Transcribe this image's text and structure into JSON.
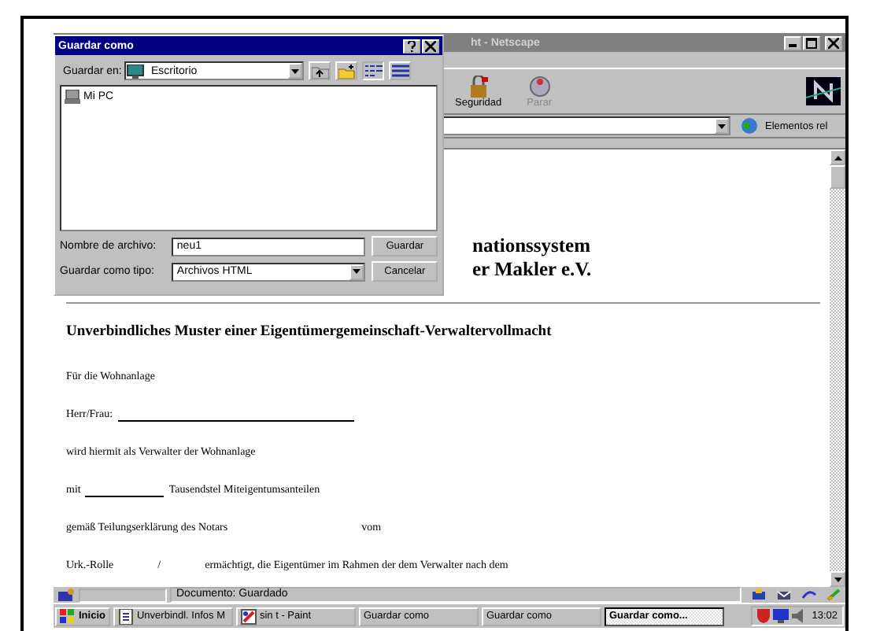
{
  "browser": {
    "title": "ht - Netscape",
    "toolbar": [
      {
        "label": "Seguridad",
        "kind": "lock",
        "disabled": false
      },
      {
        "label": "Parar",
        "kind": "stop",
        "disabled": true
      }
    ],
    "related": "Elementos rel",
    "page": {
      "heading": [
        "nationssystem",
        "er Makler e.V."
      ],
      "title": "Unverbindliches Muster einer Eigentümergemeinschaft-Verwaltervollmacht",
      "lines": [
        [
          {
            "kind": "text",
            "text": "Für die Wohnanlage"
          }
        ],
        [
          {
            "kind": "text",
            "text": "Herr/Frau:"
          },
          {
            "kind": "long_blank"
          }
        ],
        [
          {
            "kind": "text",
            "text": "wird hiermit als Verwalter der Wohnanlage"
          }
        ],
        [
          {
            "kind": "text",
            "text": "mit"
          },
          {
            "kind": "short_blank"
          },
          {
            "kind": "text",
            "text": "Tausendstel Miteigentumsanteilen"
          }
        ],
        [
          {
            "kind": "text",
            "text": "gemäß Teilungserklärung des Notars"
          },
          {
            "kind": "wide_gap"
          },
          {
            "kind": "text",
            "text": "vom"
          }
        ],
        [
          {
            "kind": "text",
            "text": "Urk.-Rolle"
          },
          {
            "kind": "narrow_gap"
          },
          {
            "kind": "text",
            "text": "/"
          },
          {
            "kind": "narrow_gap"
          },
          {
            "kind": "text",
            "text": "ermächtigt, die Eigentümer im Rahmen der dem Verwalter nach dem"
          }
        ]
      ]
    },
    "status": "Documento: Guardado"
  },
  "taskbar": {
    "start": "Inicio",
    "tasks": [
      {
        "label": "Unverbindl. Infos M",
        "kind": "doc",
        "selected": false
      },
      {
        "label": "sin t - Paint",
        "kind": "paint",
        "selected": false
      },
      {
        "label": "Guardar como",
        "kind": "none",
        "selected": false
      },
      {
        "label": "Guardar como",
        "kind": "none",
        "selected": false
      },
      {
        "label": "Guardar como...",
        "kind": "none",
        "selected": true
      }
    ],
    "time": "13:02"
  },
  "dialog": {
    "title": "Guardar como",
    "save_in_label": "Guardar en:",
    "save_in": "Escritorio",
    "items": [
      "Mi PC"
    ],
    "filename_label": "Nombre de archivo:",
    "filename": "neu1",
    "type_label": "Guardar como tipo:",
    "type": "Archivos HTML",
    "buttons": [
      "Guardar",
      "Cancelar"
    ]
  }
}
